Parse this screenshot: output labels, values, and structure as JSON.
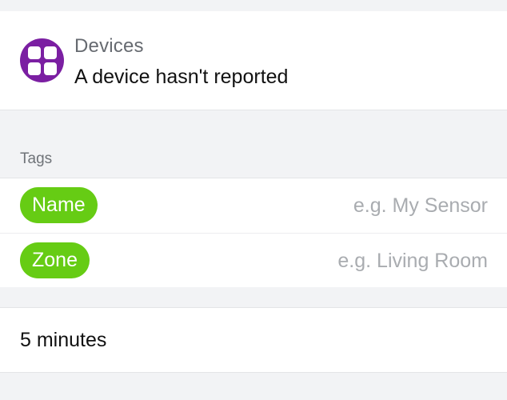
{
  "device": {
    "category": "Devices",
    "title": "A device hasn't reported",
    "icon": "grid-apps-icon",
    "icon_color": "#7b1fa2"
  },
  "tags": {
    "header": "Tags",
    "pill_color": "#66cc14",
    "items": [
      {
        "label": "Name",
        "placeholder": "e.g. My Sensor",
        "value": ""
      },
      {
        "label": "Zone",
        "placeholder": "e.g. Living Room",
        "value": ""
      }
    ]
  },
  "interval": {
    "value": "5 minutes"
  }
}
